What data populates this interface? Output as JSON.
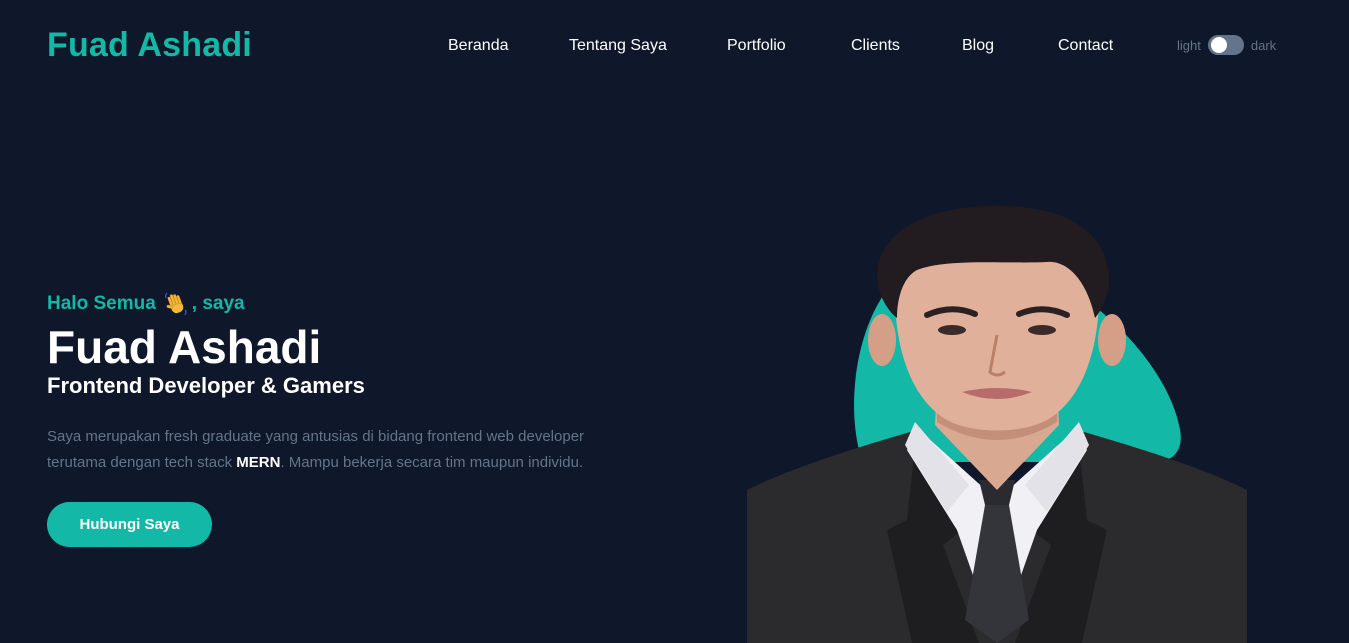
{
  "brand": {
    "name": "Fuad Ashadi",
    "color": "#14b8a6"
  },
  "nav": {
    "items": [
      {
        "label": "Beranda"
      },
      {
        "label": "Tentang Saya"
      },
      {
        "label": "Portfolio"
      },
      {
        "label": "Clients"
      },
      {
        "label": "Blog"
      },
      {
        "label": "Contact"
      }
    ]
  },
  "theme_toggle": {
    "light_label": "light",
    "dark_label": "dark",
    "state": "light"
  },
  "hero": {
    "greeting_prefix": "Halo Semua",
    "greeting_icon": "waving-hand-emoji",
    "greeting_suffix": ", saya",
    "name": "Fuad Ashadi",
    "role": "Frontend Developer & Gamers",
    "description": {
      "line1": "Saya merupakan fresh graduate yang antusias di bidang frontend web developer",
      "line2_before": "terutama dengan tech stack ",
      "line2_emphasis": "MERN",
      "line2_after": ". Mampu bekerja secara tim maupun individu."
    },
    "cta_label": "Hubungi Saya",
    "portrait_icon": "profile-photo"
  },
  "colors": {
    "background": "#0f172a",
    "accent": "#14b8a6",
    "muted_text": "#64748b",
    "text": "#ffffff"
  }
}
